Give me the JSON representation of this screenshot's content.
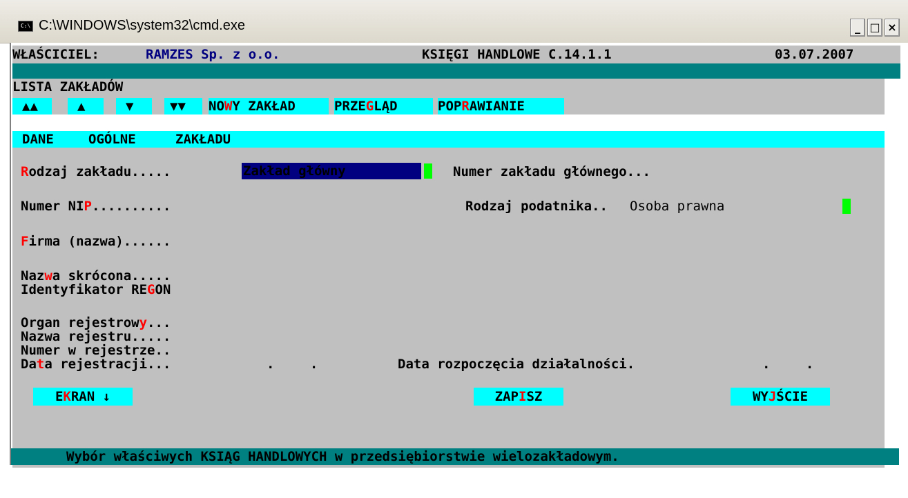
{
  "window": {
    "icon_label": "C:\\",
    "title": "C:\\WINDOWS\\system32\\cmd.exe",
    "buttons": {
      "minimize": "_",
      "maximize": "□",
      "close": "×"
    }
  },
  "header": {
    "owner_label": "WŁAŚCICIEL:",
    "owner_name": "RAMZES Sp. z o.o.",
    "app_name": "KSIĘGI HANDLOWE C.14.1.1",
    "date": "03.07.2007"
  },
  "list_title": "LISTA ZAKŁADÓW",
  "nav": {
    "first": "▲▲",
    "prev": "▲",
    "next": "▼",
    "last": "▼▼",
    "new_plain_a": "NO",
    "new_hot": "W",
    "new_plain_b": "Y ZAKŁAD",
    "view_plain_a": "PRZE",
    "view_hot": "G",
    "view_plain_b": "LĄD",
    "edit_plain_a": "POP",
    "edit_hot": "R",
    "edit_plain_b": "AWIANIE"
  },
  "section": {
    "w1": "DANE",
    "w2": "OGÓLNE",
    "w3": "ZAKŁADU"
  },
  "form": {
    "type_hot": "R",
    "type_rest": "odzaj zakładu.....",
    "type_value": "Zakład główny",
    "main_no_label": "Numer zakładu głównego...",
    "nip_plain": "Numer NI",
    "nip_hot": "P",
    "nip_dots": "..........",
    "taxpayer_label": "Rodzaj podatnika..",
    "taxpayer_value": "Osoba prawna",
    "firm_hot": "F",
    "firm_rest": "irma (nazwa)......",
    "short_a": "Naz",
    "short_hot": "w",
    "short_b": "a skrócona.....",
    "regon_a": "Identyfikator RE",
    "regon_hot": "G",
    "regon_b": "ON",
    "organ_a": "Organ rejestrow",
    "organ_hot": "y",
    "organ_b": "...",
    "regname": "Nazwa rejestru.....",
    "regnum": "Numer w rejestrze..",
    "regdate_a": "Da",
    "regdate_hot": "t",
    "regdate_b": "a rejestracji...",
    "regdate_value": ". .",
    "start_label": "Data rozpoczęcia działalności.",
    "start_value": ". ."
  },
  "buttons": {
    "screen_a": "E",
    "screen_hot": "K",
    "screen_b": "RAN ↓",
    "save_a": "ZAP",
    "save_hot": "I",
    "save_b": "SZ",
    "exit_a": "WY",
    "exit_hot": "J",
    "exit_b": "ŚCIE"
  },
  "status": "Wybór właściwych KSIĄG HANDLOWYCH w przedsiębiorstwie wielozakładowym.",
  "colors": {
    "console_gray": "#c0c0c0",
    "teal": "#008080",
    "cyan": "#00ffff",
    "hotkey_red": "#ff0000",
    "value_yellow": "#ffff00",
    "field_green": "#00ff00",
    "navy": "#000080"
  }
}
